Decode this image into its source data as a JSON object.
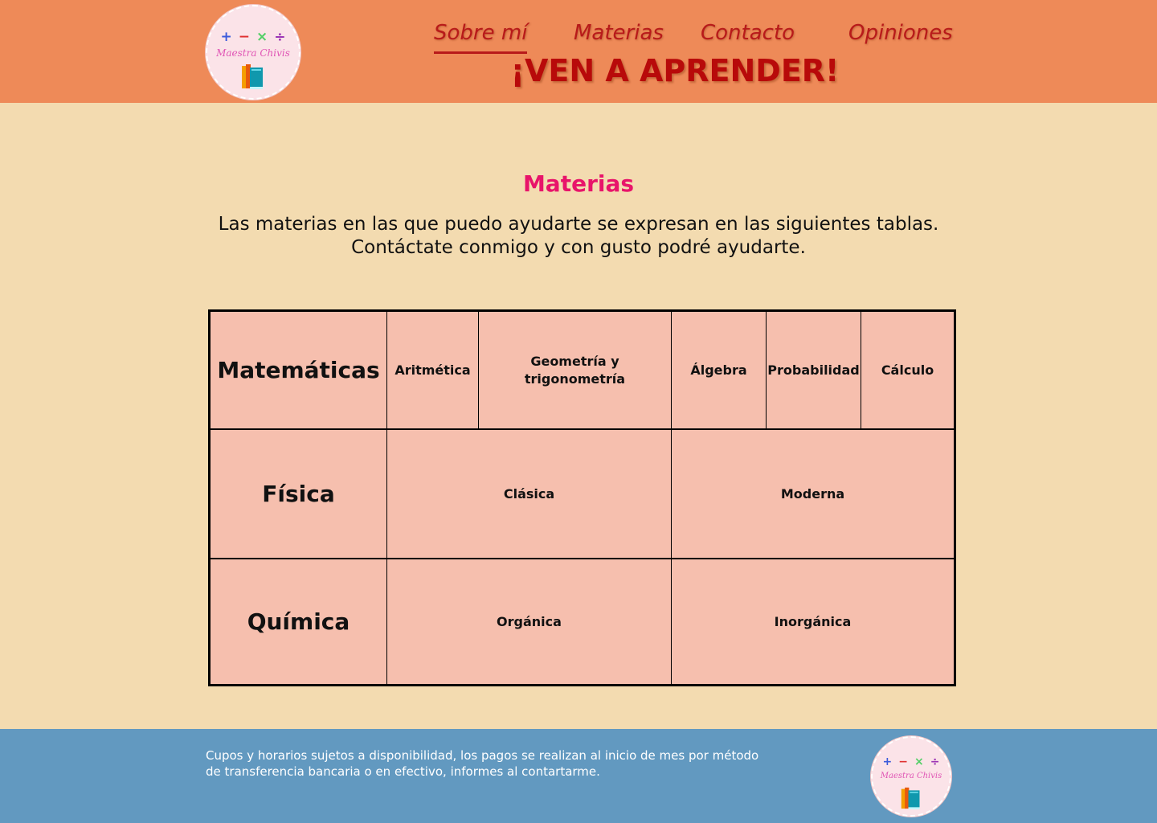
{
  "header": {
    "logo": {
      "operators": [
        "+",
        "−",
        "×",
        "÷"
      ],
      "operator_colors": [
        "#3B5BDB",
        "#E03131",
        "#51CF66",
        "#9C36B5"
      ],
      "brand_text": "Maestra Chivis",
      "icon": "books-icon"
    },
    "nav": [
      {
        "label": "Sobre mí",
        "active": true
      },
      {
        "label": "Materias",
        "active": false
      },
      {
        "label": "Contacto",
        "active": false
      },
      {
        "label": "Opiniones",
        "active": false
      }
    ],
    "tagline": "¡VEN A APRENDER!"
  },
  "main": {
    "title": "Materias",
    "intro_line1": "Las materias en las que puedo ayudarte se expresan en las siguientes tablas.",
    "intro_line2": "Contáctate conmigo y con gusto podré ayudarte.",
    "table": {
      "matematicas": {
        "label": "Matemáticas",
        "items": [
          "Aritmética",
          "Geometría y trigonometría",
          "Álgebra",
          "Probabilidad",
          "Cálculo"
        ]
      },
      "fisica": {
        "label": "Física",
        "items": [
          "Clásica",
          "Moderna"
        ]
      },
      "quimica": {
        "label": "Química",
        "items": [
          "Orgánica",
          "Inorgánica"
        ]
      }
    }
  },
  "footer": {
    "note": "Cupos y horarios sujetos a disponibilidad, los pagos se realizan al inicio de mes por método de transferencia bancaria o en efectivo, informes al contartarme."
  },
  "colors": {
    "header_bg": "#EE8A58",
    "body_bg": "#F3DBB0",
    "footer_bg": "#6299C0",
    "nav_text": "#B81A1A",
    "title_pink": "#E8146A",
    "table_bg": "#F6BFAE"
  }
}
